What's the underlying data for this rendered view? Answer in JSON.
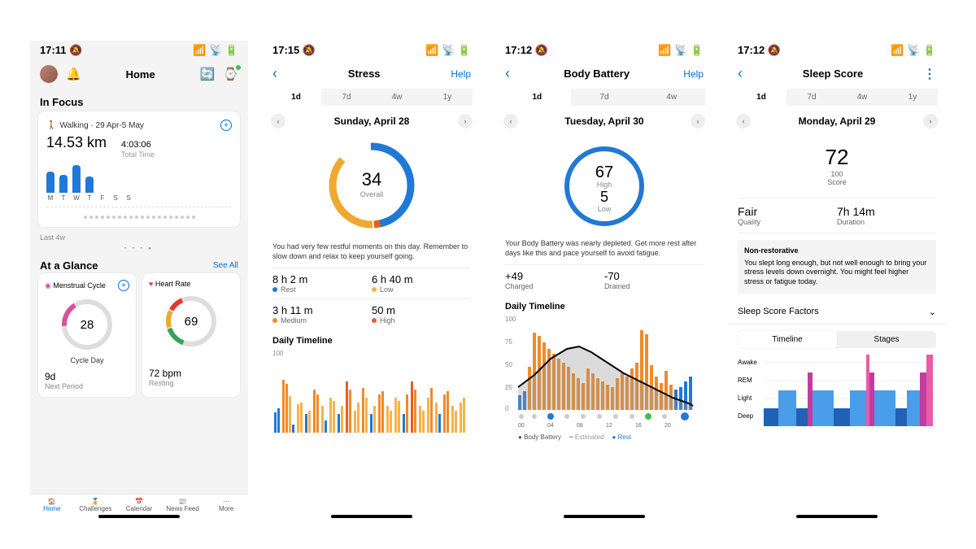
{
  "home": {
    "status_time": "17:11",
    "title": "Home",
    "in_focus": "In Focus",
    "walking_label": "Walking · 29 Apr-5 May",
    "distance": "14.53 km",
    "total_time": "4:03:06",
    "total_time_label": "Total Time",
    "day_labels": [
      "M",
      "T",
      "W",
      "T",
      "F",
      "S",
      "S"
    ],
    "last4w": "Last 4w",
    "at_glance": "At a Glance",
    "see_all": "See All",
    "menstrual": {
      "title": "Menstrual Cycle",
      "value": "28",
      "caption": "Cycle Day",
      "footer_value": "9d",
      "footer_label": "Next Period"
    },
    "heart": {
      "title": "Heart Rate",
      "value": "69",
      "footer_value": "72 bpm",
      "footer_label": "Resting"
    },
    "tabbar": {
      "home": "Home",
      "challenges": "Challenges",
      "calendar": "Calendar",
      "news": "News Feed",
      "more": "More"
    }
  },
  "stress": {
    "status_time": "17:15",
    "title": "Stress",
    "help": "Help",
    "tabs": [
      "1d",
      "7d",
      "4w",
      "1y"
    ],
    "date": "Sunday, April 28",
    "score": "34",
    "score_label": "Overall",
    "desc": "You had very few restful moments on this day. Remember to slow down and relax to keep yourself going.",
    "stats": [
      {
        "value": "8 h 2 m",
        "label": "Rest",
        "color": "#2079d6"
      },
      {
        "value": "6 h 40 m",
        "label": "Low",
        "color": "#f7b24a"
      },
      {
        "value": "3 h 11 m",
        "label": "Medium",
        "color": "#f08a2a"
      },
      {
        "value": "50 m",
        "label": "High",
        "color": "#e85c1e"
      }
    ],
    "timeline_title": "Daily Timeline",
    "y_max": "100"
  },
  "battery": {
    "status_time": "17:12",
    "title": "Body Battery",
    "help": "Help",
    "tabs": [
      "1d",
      "7d",
      "4w"
    ],
    "date": "Tuesday, April 30",
    "high_value": "67",
    "high_label": "High",
    "low_value": "5",
    "low_label": "Low",
    "desc": "Your Body Battery was nearly depleted. Get more rest after days like this and pace yourself to avoid fatigue.",
    "stats": [
      {
        "value": "+49",
        "label": "Charged"
      },
      {
        "value": "-70",
        "label": "Drained"
      }
    ],
    "timeline_title": "Daily Timeline",
    "y_ticks": [
      "100",
      "75",
      "50",
      "25",
      "0"
    ],
    "x_ticks": [
      "00",
      "04",
      "08",
      "12",
      "16",
      "20"
    ],
    "legend": {
      "a": "Body Battery",
      "b": "Estimated",
      "c": "Rest"
    }
  },
  "sleep": {
    "status_time": "17:12",
    "title": "Sleep Score",
    "tabs": [
      "1d",
      "7d",
      "4w",
      "1y"
    ],
    "date": "Monday, April 29",
    "score": "72",
    "score_denom": "100",
    "score_label": "Score",
    "quality": "Fair",
    "quality_label": "Quality",
    "duration": "7h 14m",
    "duration_label": "Duration",
    "info_title": "Non-restorative",
    "info_body": "You slept long enough, but not well enough to bring your stress levels down overnight. You might feel higher stress or fatigue today.",
    "factors": "Sleep Score Factors",
    "seg": [
      "Timeline",
      "Stages"
    ],
    "stage_labels": [
      "Awake",
      "REM",
      "Light",
      "Deep"
    ]
  },
  "chart_data": [
    {
      "type": "bar",
      "title": "Walking daily distance",
      "categories": [
        "M",
        "T",
        "W",
        "T",
        "F",
        "S",
        "S"
      ],
      "values": [
        3.2,
        2.8,
        4.1,
        2.5,
        0,
        0,
        0
      ],
      "ylim": [
        0,
        5
      ]
    },
    {
      "type": "bar",
      "title": "Stress Daily Timeline",
      "x_range_hours": [
        0,
        24
      ],
      "ylim": [
        0,
        100
      ],
      "series": [
        {
          "name": "stress_level",
          "color_legend": {
            "rest": "#2079d6",
            "low": "#f7b24a",
            "medium": "#f08a2a",
            "high": "#e85c1e"
          },
          "values": [
            20,
            25,
            60,
            55,
            40,
            10,
            30,
            35,
            20,
            25,
            50,
            45,
            30,
            15,
            40,
            35,
            20,
            30,
            60,
            50,
            25,
            35,
            55,
            40,
            20,
            30,
            45,
            50,
            30,
            25,
            40,
            35,
            20,
            45,
            60,
            50,
            30,
            25,
            40,
            55,
            35,
            20,
            45,
            50,
            30,
            25,
            35,
            40
          ]
        }
      ]
    },
    {
      "type": "area",
      "title": "Body Battery Daily Timeline",
      "x": [
        0,
        2,
        4,
        6,
        8,
        10,
        12,
        14,
        16,
        18,
        20,
        22,
        24
      ],
      "ylim": [
        0,
        100
      ],
      "series": [
        {
          "name": "Body Battery",
          "values": [
            20,
            30,
            45,
            55,
            67,
            60,
            50,
            40,
            30,
            20,
            12,
            8,
            5
          ],
          "color": "#000"
        },
        {
          "name": "Drain/Charge bars",
          "type": "bar",
          "values": [
            10,
            15,
            40,
            85,
            80,
            70,
            60,
            55,
            50,
            45,
            40,
            30,
            25,
            20,
            35,
            30,
            25,
            22,
            20,
            18,
            25,
            30,
            28,
            35
          ],
          "color": "#f08a2a"
        },
        {
          "name": "Rest bars",
          "type": "bar",
          "values": [
            20,
            25,
            15,
            10,
            0,
            0,
            0,
            0,
            0,
            0,
            0,
            0,
            0,
            0,
            0,
            0,
            0,
            0,
            0,
            0,
            0,
            0,
            20,
            25
          ],
          "color": "#2079d6"
        }
      ]
    },
    {
      "type": "heatmap",
      "title": "Sleep Stages Timeline",
      "y_categories": [
        "Awake",
        "REM",
        "Light",
        "Deep"
      ],
      "x_range_hours": [
        0,
        7.25
      ],
      "segments": [
        {
          "stage": "Deep",
          "start": 0.0,
          "end": 0.6
        },
        {
          "stage": "Light",
          "start": 0.6,
          "end": 1.4
        },
        {
          "stage": "Deep",
          "start": 1.4,
          "end": 1.9
        },
        {
          "stage": "REM",
          "start": 1.9,
          "end": 2.1
        },
        {
          "stage": "Light",
          "start": 2.1,
          "end": 3.0
        },
        {
          "stage": "Deep",
          "start": 3.0,
          "end": 3.7
        },
        {
          "stage": "Light",
          "start": 3.7,
          "end": 4.4
        },
        {
          "stage": "Awake",
          "start": 4.4,
          "end": 4.5
        },
        {
          "stage": "REM",
          "start": 4.5,
          "end": 4.7
        },
        {
          "stage": "Light",
          "start": 4.7,
          "end": 5.6
        },
        {
          "stage": "Deep",
          "start": 5.6,
          "end": 6.1
        },
        {
          "stage": "Light",
          "start": 6.1,
          "end": 6.7
        },
        {
          "stage": "REM",
          "start": 6.7,
          "end": 7.0
        },
        {
          "stage": "Awake",
          "start": 7.0,
          "end": 7.25
        }
      ],
      "colors": {
        "Awake": "#e85ca8",
        "REM": "#c23ca0",
        "Light": "#4a9de8",
        "Deep": "#2062b5"
      }
    }
  ]
}
